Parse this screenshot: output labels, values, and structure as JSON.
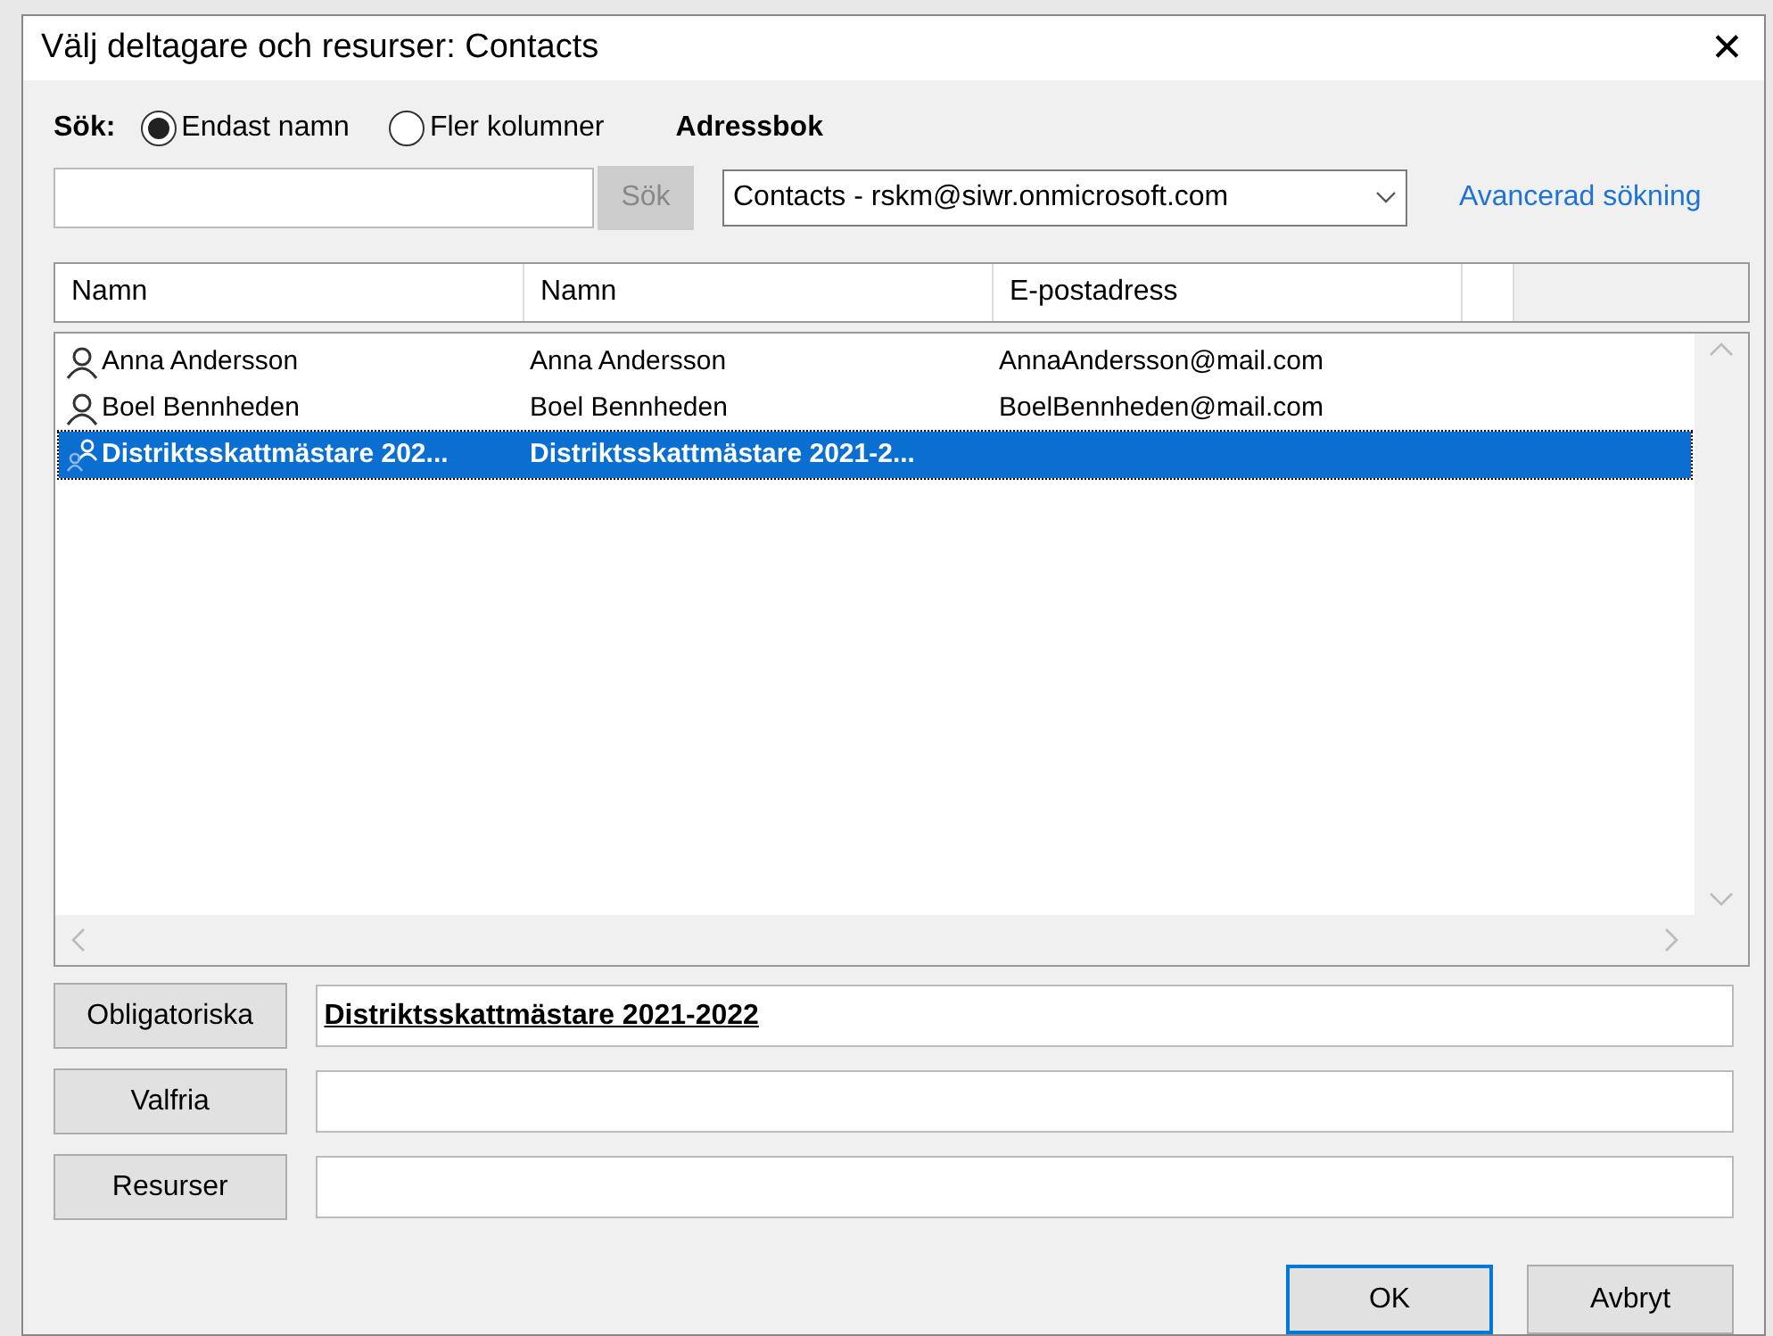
{
  "window": {
    "title": "Välj deltagare och resurser: Contacts",
    "close": "✕"
  },
  "search": {
    "label": "Sök:",
    "options": [
      {
        "label": "Endast namn",
        "selected": true
      },
      {
        "label": "Fler kolumner",
        "selected": false
      }
    ],
    "button": {
      "label": "Sök",
      "disabled": true
    }
  },
  "address_book": {
    "label": "Adressbok",
    "value": "Contacts - rskm@siwr.onmicrosoft.com"
  },
  "advanced_link": "Avancerad sökning",
  "table": {
    "columns": [
      "Namn",
      "Namn",
      "E-postadress"
    ],
    "rows": [
      {
        "kind": "contact",
        "selected": false,
        "cells": [
          "Anna Andersson",
          "Anna Andersson",
          "AnnaAndersson@mail.com"
        ]
      },
      {
        "kind": "contact",
        "selected": false,
        "cells": [
          "Boel Bennheden",
          "Boel Bennheden",
          "BoelBennheden@mail.com"
        ]
      },
      {
        "kind": "group",
        "selected": true,
        "cells": [
          "Distriktsskattmästare 202...",
          "Distriktsskattmästare 2021-2...",
          ""
        ]
      }
    ]
  },
  "recipients": [
    {
      "button": "Obligatoriska",
      "value": "Distriktsskattmästare 2021-2022",
      "resolved": true
    },
    {
      "button": "Valfria"
    },
    {
      "button": "Resurser"
    }
  ],
  "buttons": [
    {
      "label": "OK",
      "default": true
    },
    {
      "label": "Avbryt",
      "default": false
    }
  ]
}
